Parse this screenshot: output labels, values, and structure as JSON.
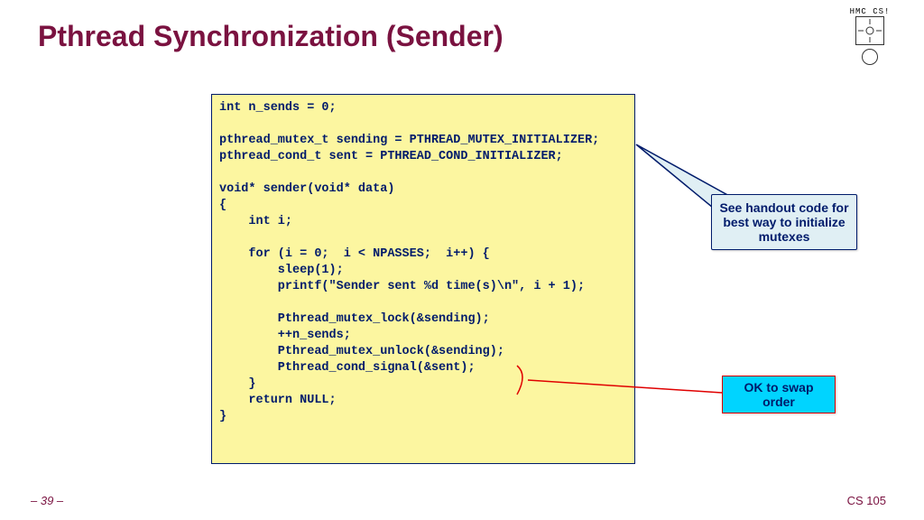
{
  "title": "Pthread Synchronization (Sender)",
  "logo_text": "HMC CS!",
  "code": "int n_sends = 0;\n\npthread_mutex_t sending = PTHREAD_MUTEX_INITIALIZER;\npthread_cond_t sent = PTHREAD_COND_INITIALIZER;\n\nvoid* sender(void* data)\n{\n    int i;\n\n    for (i = 0;  i < NPASSES;  i++) {\n        sleep(1);\n        printf(\"Sender sent %d time(s)\\n\", i + 1);\n\n        Pthread_mutex_lock(&sending);\n        ++n_sends;\n        Pthread_mutex_unlock(&sending);\n        Pthread_cond_signal(&sent);\n    }\n    return NULL;\n}",
  "callout1": "See handout code for best way to initialize mutexes",
  "callout2": "OK to swap order",
  "page_num": "– 39 –",
  "course": "CS 105"
}
